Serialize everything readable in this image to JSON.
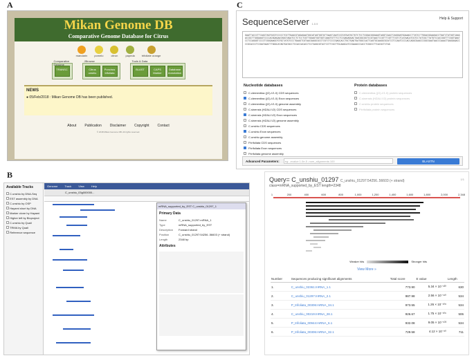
{
  "labels": {
    "a": "A",
    "b": "B",
    "c": "C"
  },
  "panelA": {
    "title": "Mikan Genome DB",
    "subtitle": "Comparative Genome Database for Citrus",
    "fruits": [
      {
        "name": "mandarin",
        "color": "#f0a020"
      },
      {
        "name": "pomelo",
        "color": "#e8d040"
      },
      {
        "name": "citron",
        "color": "#d8c030"
      },
      {
        "name": "papeda",
        "color": "#a0b040"
      },
      {
        "name": "trifoliate orange",
        "color": "#c8a030"
      }
    ],
    "groups": [
      {
        "caption": "Comparative Genome",
        "buttons": [
          "TRANSC"
        ]
      },
      {
        "caption": "JBrowse",
        "buttons": [
          "Citrus unshiu",
          "Poncirus trifoliata"
        ]
      },
      {
        "caption": "Tools & Data",
        "buttons": [
          "BLAST",
          "CAPS Marker",
          "Database Annotation"
        ]
      }
    ],
    "news_title": "NEWS",
    "news_item": "● 05/Feb/2018 : Mikan Genome DB has been published.",
    "footer": [
      "About",
      "Publication",
      "Disclaimer",
      "Copyright",
      "Contact"
    ],
    "copyright": "© 2018 Mikan Genome DB. All rights reserved."
  },
  "panelB": {
    "tracks_header": "Available Tracks",
    "tracks": [
      "C.unshiu by DNA-Seq",
      "EST assembly by DNA",
      "C.unshiu by OSP",
      "Hayami short by DNA",
      "Marker clone by Hayami",
      "Higher left by Bioproject",
      "C.unshiu by Quali",
      "TRMA by Quali",
      "Reference sequence"
    ],
    "menu": [
      "Genome",
      "Track",
      "View",
      "Help"
    ],
    "locus": "C_unshiu_03g000000...",
    "popup_title": "mRNA_supported_by_EST C_unshiu_01297_1",
    "popup_section": "Primary Data",
    "attr_section": "Attributes",
    "popup_fields": [
      {
        "k": "Name",
        "v": "C_unshiu_01297.mRNA_1"
      },
      {
        "k": "Type",
        "v": "mRNA_supported_by_EST"
      },
      {
        "k": "Description",
        "v": "Forward strand"
      },
      {
        "k": "Position",
        "v": "C_unshiu_01297:54256..56603 (+ strand)"
      },
      {
        "k": "Length",
        "v": "2348 bp"
      }
    ]
  },
  "panelC": {
    "brand": "SequenceServer",
    "version": "1.0.9",
    "help": "Help & Support",
    "sequence": "GAATTACCCTTCAGCTAGTGCGTCCCCCTCGTTGAACGTAGAGAATGGCATAGTGGTATTAAATCAATCCGTATGATGCTGTCTCCTCGGACGGGAAGTAGGTCAACTCAGGGATGGAAACCTTATCCTTGGACGGAAGACCTGATCTATGGTCAAGACCGCTTGGGAAGTCCCCACGGAGAATAGGTAGATCCTCTCCTCGTTGGAGTGGTGGTCAAGTGTTTCCTCCGAGAGGACTAACGGCGGTCCGTAACTCCGTTTCGTTTCGTCTCATAACATCGTCCTATCGCTTATGTCCACCGGTTTCGGTGAATCCTCCAGGGTCCCCTCGGGAAGGTGTGCTATGTCCCTGAAGTCGTAACGAGGCGCCTCGTCTCCCCGAGCACCTGCTGAGTGATGGCCACTCAGTGCAAGGCGCATCCTCCAATCCCCACCAGGCGAACCCGGCGAATAACCCAAACTGAGGAGACCCCGCACCCTCCGATAGATTTGGGCATAGTGATACCTCCACCACACCTCCTAGGCGTACTCCTTCGCTTGCAAGCATCCGAAACCCACCTCGGCCTTCACGCTCTAG",
    "nucleotide_header": "Nucleotide databases",
    "protein_header": "Protein databases",
    "nucleotide": [
      {
        "name": "C.clementina ((G)-V1.0) CDS sequences",
        "on": false
      },
      {
        "name": "C.clementina ((G)-V1.0) Exon sequences",
        "on": true
      },
      {
        "name": "C.clementina ((G)-V1.0) genome assembly",
        "on": false
      },
      {
        "name": "C.sinensis (HZAU-V2) CDS sequences",
        "on": false
      },
      {
        "name": "C.sinensis (HZAU-V2) Exon sequences",
        "on": true
      },
      {
        "name": "C.sinensis (HZAU-V2) genome assembly",
        "on": false
      },
      {
        "name": "C.unshiu CDS sequences",
        "on": false
      },
      {
        "name": "C.unshiu Exon sequences",
        "on": true
      },
      {
        "name": "C.unshiu genome assembly",
        "on": false
      },
      {
        "name": "P.trifoliata CDS sequences",
        "on": false
      },
      {
        "name": "P.trifoliata Exon sequences",
        "on": true
      },
      {
        "name": "P.trifoliata genome assembly",
        "on": false
      }
    ],
    "protein": [
      "C.clementina ((G)-V1.0) protein sequences",
      "C.sinensis (HZAU-V2) protein sequences",
      "C.unshiu protein sequences",
      "P.trifoliata protein sequences"
    ],
    "adv_label": "Advanced Parameters:",
    "adv_placeholder": "eg: -evalue 1.0e-5 -num_alignments 100",
    "blast": "BLASTN"
  },
  "panelD": {
    "query": "Query= C_unshiu_01297",
    "query_small": "C_unshiu_01297:54256..56603 (+ strand)",
    "class": "class=mRNA_supported_by_EST length=2348",
    "page": "1/1",
    "ticks": [
      "1",
      "200",
      "400",
      "600",
      "800",
      "1,000",
      "1,200",
      "1,400",
      "1,600",
      "1,800",
      "2,000",
      "2,348"
    ],
    "weaker": "Weaker hits",
    "stronger": "Stronger hits",
    "more": "View More »",
    "headers": [
      "Number",
      "Sequences producing significant alignments",
      "Total score",
      "E value",
      "Length"
    ],
    "rows": [
      [
        "1.",
        "C_unshiu_02361:mRNA_1.1",
        "773.90",
        "5.34 × 10⁻¹³⁰",
        "630"
      ],
      [
        "2.",
        "C_unshiu_01297:mRNA_2.1",
        "987.98",
        "2.56 × 10⁻¹¹⁰",
        "534"
      ],
      [
        "3.",
        "P_trifoliata_00306:mRNA_34.1",
        "973.55",
        "1.26 × 10⁻¹⁰⁸",
        "534"
      ],
      [
        "4.",
        "C_unshiu_00219:mRNA_28.1",
        "926.67",
        "1.75 × 10⁻¹⁰⁶",
        "506"
      ],
      [
        "5.",
        "P_trifoliata_00944:mRNA_6.1",
        "932.08",
        "9.05 × 10⁻¹⁰³",
        "534"
      ],
      [
        "6.",
        "P_trifoliata_00306:mRNA_32.1",
        "729.58",
        "4.12 × 10⁻⁸⁰",
        "711"
      ]
    ]
  }
}
